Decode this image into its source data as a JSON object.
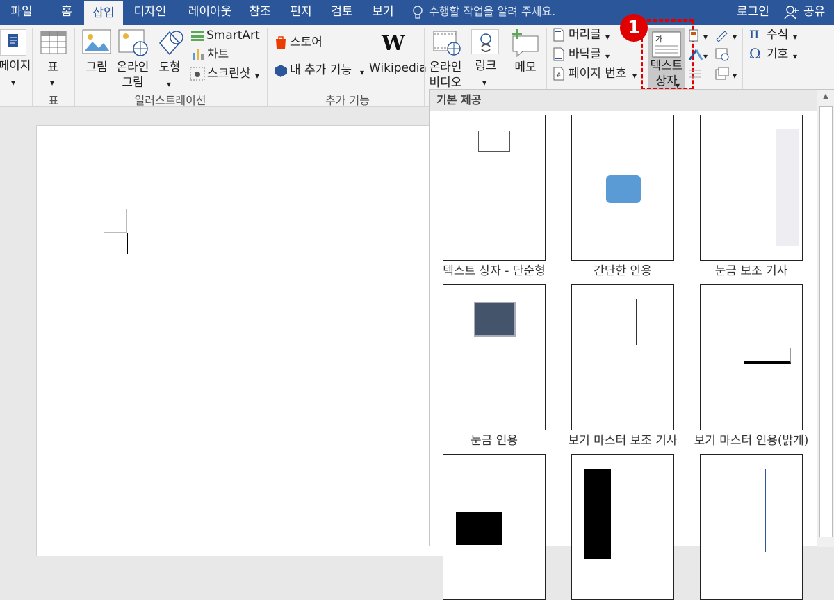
{
  "tabs": [
    {
      "label": "파일"
    },
    {
      "label": "홈"
    },
    {
      "label": "삽입"
    },
    {
      "label": "디자인"
    },
    {
      "label": "레이아웃"
    },
    {
      "label": "참조"
    },
    {
      "label": "편지"
    },
    {
      "label": "검토"
    },
    {
      "label": "보기"
    }
  ],
  "tell_me": "수행할 작업을 알려 주세요.",
  "login": "로그인",
  "share": "공유",
  "ribbon": {
    "page_label": "페이지",
    "table_label": "표",
    "group_table": "표",
    "picture": "그림",
    "online_picture": "온라인\n그림",
    "shapes": "도형",
    "smartart": "SmartArt",
    "chart": "차트",
    "screenshot": "스크린샷",
    "group_illustration": "일러스트레이션",
    "store": "스토어",
    "my_addins": "내 추가 기능",
    "wikipedia": "Wikipedia",
    "group_addins": "추가 기능",
    "online_video": "온라인\n비디오",
    "link": "링크",
    "memo": "메모",
    "header": "머리글",
    "footer": "바닥글",
    "page_number": "페이지 번호",
    "textbox": "텍스트\n상자",
    "equation": "수식",
    "symbol": "기호",
    "step_badge": "1"
  },
  "gallery": {
    "title": "기본 제공",
    "items": [
      {
        "label": "텍스트 상자 - 단순형"
      },
      {
        "label": "간단한 인용"
      },
      {
        "label": "눈금 보조 기사"
      },
      {
        "label": "눈금 인용"
      },
      {
        "label": "보기 마스터 보조 기사"
      },
      {
        "label": "보기 마스터 인용(밝게)"
      }
    ]
  },
  "colors": {
    "accent": "#2b579a",
    "highlight": "#e00000",
    "quote_blue": "#5b9bd5",
    "slate": "#44546a"
  }
}
